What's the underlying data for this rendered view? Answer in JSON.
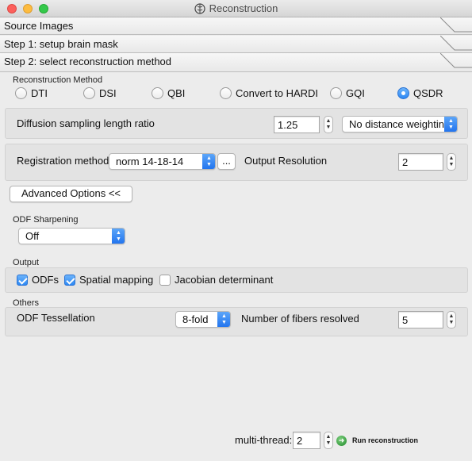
{
  "window": {
    "title": "Reconstruction"
  },
  "steps": [
    {
      "label": "Source Images"
    },
    {
      "label": "Step 1: setup brain mask"
    },
    {
      "label": "Step 2: select reconstruction method"
    }
  ],
  "recon_method": {
    "label": "Reconstruction Method",
    "options": [
      "DTI",
      "DSI",
      "QBI",
      "Convert to HARDI",
      "GQI",
      "QSDR"
    ],
    "selected": "QSDR"
  },
  "diffusion": {
    "label": "Diffusion sampling length ratio",
    "value": "1.25",
    "weighting": "No distance weighting"
  },
  "registration": {
    "label": "Registration method",
    "value": "norm 14-18-14",
    "browse_label": "...",
    "resolution_label": "Output Resolution",
    "resolution_value": "2"
  },
  "advanced_button": "Advanced Options <<",
  "odf_sharpening": {
    "label": "ODF Sharpening",
    "value": "Off"
  },
  "output": {
    "label": "Output",
    "items": [
      {
        "label": "ODFs",
        "checked": true
      },
      {
        "label": "Spatial mapping",
        "checked": true
      },
      {
        "label": "Jacobian determinant",
        "checked": false
      }
    ]
  },
  "others": {
    "label": "Others",
    "tessellation_label": "ODF Tessellation",
    "tessellation_value": "8-fold",
    "fibers_label": "Number of fibers resolved",
    "fibers_value": "5"
  },
  "footer": {
    "thread_label": "multi-thread:",
    "thread_value": "2",
    "run_label": "Run reconstruction"
  },
  "colors": {
    "accent": "#2d88f4",
    "panel": "#e3e3e3",
    "background": "#ececec"
  },
  "icons": {
    "window": "brain-icon",
    "run": "run-arrow-icon"
  }
}
